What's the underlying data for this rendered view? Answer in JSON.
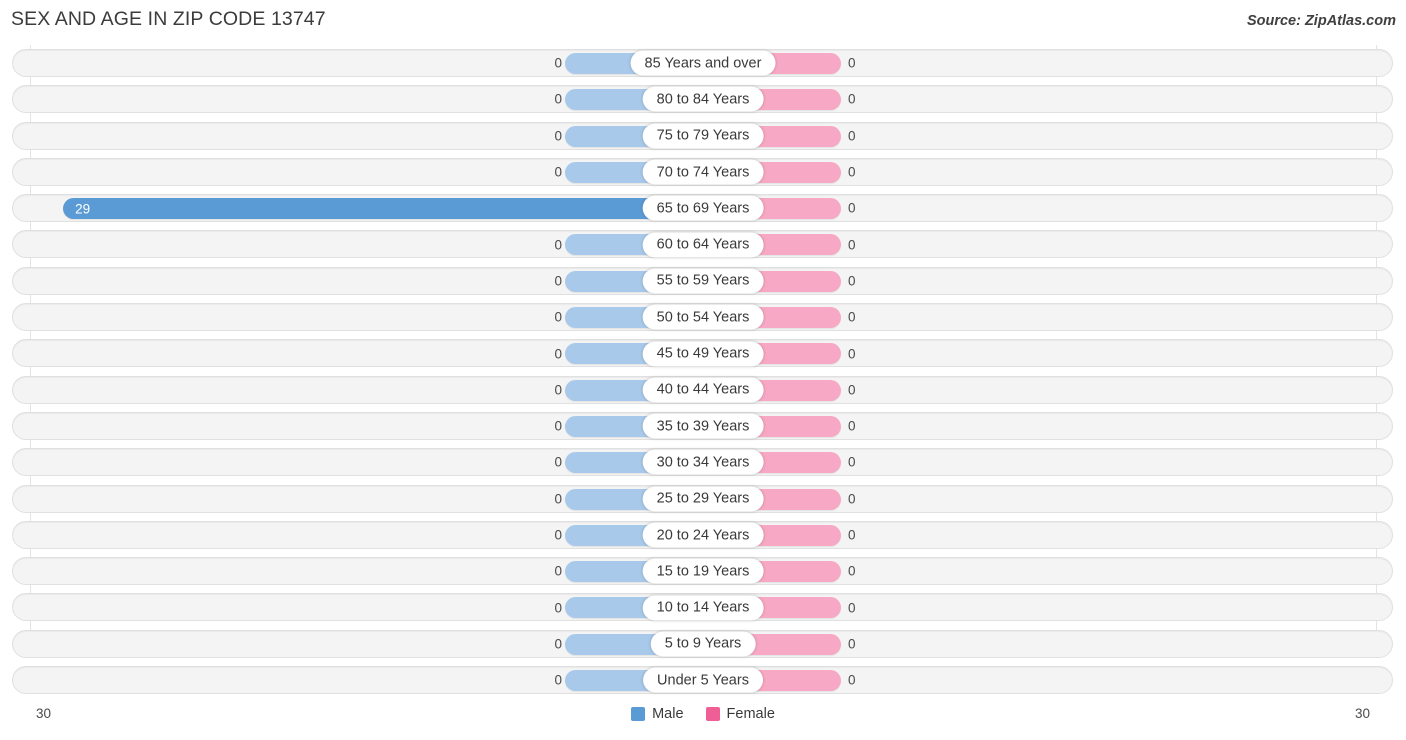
{
  "header": {
    "title": "SEX AND AGE IN ZIP CODE 13747",
    "source": "Source: ZipAtlas.com"
  },
  "axis": {
    "left_max": "30",
    "right_max": "30"
  },
  "legend": [
    {
      "label": "Male",
      "color": "#5b9bd5",
      "icon": "square-swatch-icon"
    },
    {
      "label": "Female",
      "color": "#ef5f95",
      "icon": "square-swatch-icon"
    }
  ],
  "colors": {
    "male_bar": "#5b9bd5",
    "male_bar_light": "#a8c9ea",
    "female_bar": "#ef5f95",
    "female_bar_light": "#f7a8c4",
    "track": "#f4f4f4",
    "track_border": "#e0e0e0",
    "grid": "#e3e3e3"
  },
  "chart_data": {
    "type": "bar",
    "subtype": "diverging-population-pyramid",
    "title": "SEX AND AGE IN ZIP CODE 13747",
    "xlabel": "",
    "ylabel": "",
    "xlim": [
      30,
      30
    ],
    "grid": true,
    "legend_position": "bottom-center",
    "categories": [
      "85 Years and over",
      "80 to 84 Years",
      "75 to 79 Years",
      "70 to 74 Years",
      "65 to 69 Years",
      "60 to 64 Years",
      "55 to 59 Years",
      "50 to 54 Years",
      "45 to 49 Years",
      "40 to 44 Years",
      "35 to 39 Years",
      "30 to 34 Years",
      "25 to 29 Years",
      "20 to 24 Years",
      "15 to 19 Years",
      "10 to 14 Years",
      "5 to 9 Years",
      "Under 5 Years"
    ],
    "series": [
      {
        "name": "Male",
        "values": [
          0,
          0,
          0,
          0,
          29,
          0,
          0,
          0,
          0,
          0,
          0,
          0,
          0,
          0,
          0,
          0,
          0,
          0
        ]
      },
      {
        "name": "Female",
        "values": [
          0,
          0,
          0,
          0,
          0,
          0,
          0,
          0,
          0,
          0,
          0,
          0,
          0,
          0,
          0,
          0,
          0,
          0
        ]
      }
    ]
  },
  "rows": [
    {
      "label": "85 Years and over",
      "male": "0",
      "female": "0",
      "male_value": 0,
      "female_value": 0
    },
    {
      "label": "80 to 84 Years",
      "male": "0",
      "female": "0",
      "male_value": 0,
      "female_value": 0
    },
    {
      "label": "75 to 79 Years",
      "male": "0",
      "female": "0",
      "male_value": 0,
      "female_value": 0
    },
    {
      "label": "70 to 74 Years",
      "male": "0",
      "female": "0",
      "male_value": 0,
      "female_value": 0
    },
    {
      "label": "65 to 69 Years",
      "male": "29",
      "female": "0",
      "male_value": 29,
      "female_value": 0
    },
    {
      "label": "60 to 64 Years",
      "male": "0",
      "female": "0",
      "male_value": 0,
      "female_value": 0
    },
    {
      "label": "55 to 59 Years",
      "male": "0",
      "female": "0",
      "male_value": 0,
      "female_value": 0
    },
    {
      "label": "50 to 54 Years",
      "male": "0",
      "female": "0",
      "male_value": 0,
      "female_value": 0
    },
    {
      "label": "45 to 49 Years",
      "male": "0",
      "female": "0",
      "male_value": 0,
      "female_value": 0
    },
    {
      "label": "40 to 44 Years",
      "male": "0",
      "female": "0",
      "male_value": 0,
      "female_value": 0
    },
    {
      "label": "35 to 39 Years",
      "male": "0",
      "female": "0",
      "male_value": 0,
      "female_value": 0
    },
    {
      "label": "30 to 34 Years",
      "male": "0",
      "female": "0",
      "male_value": 0,
      "female_value": 0
    },
    {
      "label": "25 to 29 Years",
      "male": "0",
      "female": "0",
      "male_value": 0,
      "female_value": 0
    },
    {
      "label": "20 to 24 Years",
      "male": "0",
      "female": "0",
      "male_value": 0,
      "female_value": 0
    },
    {
      "label": "15 to 19 Years",
      "male": "0",
      "female": "0",
      "male_value": 0,
      "female_value": 0
    },
    {
      "label": "10 to 14 Years",
      "male": "0",
      "female": "0",
      "male_value": 0,
      "female_value": 0
    },
    {
      "label": "5 to 9 Years",
      "male": "0",
      "female": "0",
      "male_value": 0,
      "female_value": 0
    },
    {
      "label": "Under 5 Years",
      "male": "0",
      "female": "0",
      "male_value": 0,
      "female_value": 0
    }
  ]
}
